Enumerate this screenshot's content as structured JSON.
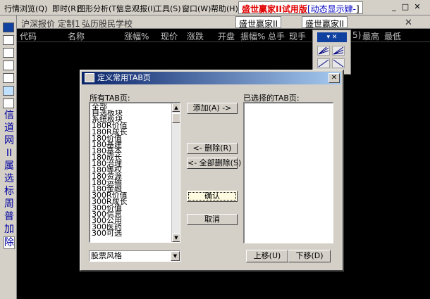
{
  "menu": {
    "items": [
      "行情浏览(Q)",
      "即时(R)",
      "图形分析(T)",
      "信息观报(I)",
      "工具(S)",
      "窗口(W)",
      "帮助(H)"
    ],
    "brand_red": "盛世赢家II试用版",
    "brand_blue": "[动态显示肄-",
    "brand_tail": "]"
  },
  "lefttoolbar": {
    "chars": [
      "信",
      "道",
      "网",
      "II",
      "属",
      "选",
      "标",
      "周",
      "普",
      "加",
      "除"
    ]
  },
  "tabs": {
    "items": [
      "沪深报价",
      "定制1",
      "弘历股民学校"
    ],
    "chart_tab1": "盛世赢家II",
    "chart_tab2": "盛世赢家II"
  },
  "columns": {
    "left": [
      "代码",
      "名称",
      "涨幅%",
      "现价",
      "涨跌",
      "开盘",
      "振幅%",
      "总手",
      "现手"
    ],
    "right": [
      "最高",
      "最低"
    ],
    "right_partial": "5)"
  },
  "dialog": {
    "title": "定义常用TAB页",
    "close": "✕",
    "all_label": "所有TAB页:",
    "selected_label": "已选择的TAB页:",
    "all_items": [
      "全部",
      "自选板块",
      "系统板块",
      "180R价值",
      "180R成长",
      "180价值",
      "180基建",
      "180基本",
      "180成长",
      "180治理",
      "180等权",
      "180资源",
      "180运输",
      "180金融",
      "300R价值",
      "300R成长",
      "300价值",
      "300信息",
      "300公用",
      "300医药",
      "300可选"
    ],
    "selected_items": [],
    "add_button": "添加(A) ->",
    "remove_button": "<- 删除(R)",
    "remove_all_button": "<- 全部删除(S)",
    "ok_button": "确认",
    "cancel_button": "取消",
    "style_select": "股票风格",
    "up_button": "上移(U)",
    "down_button": "下移(D)"
  }
}
